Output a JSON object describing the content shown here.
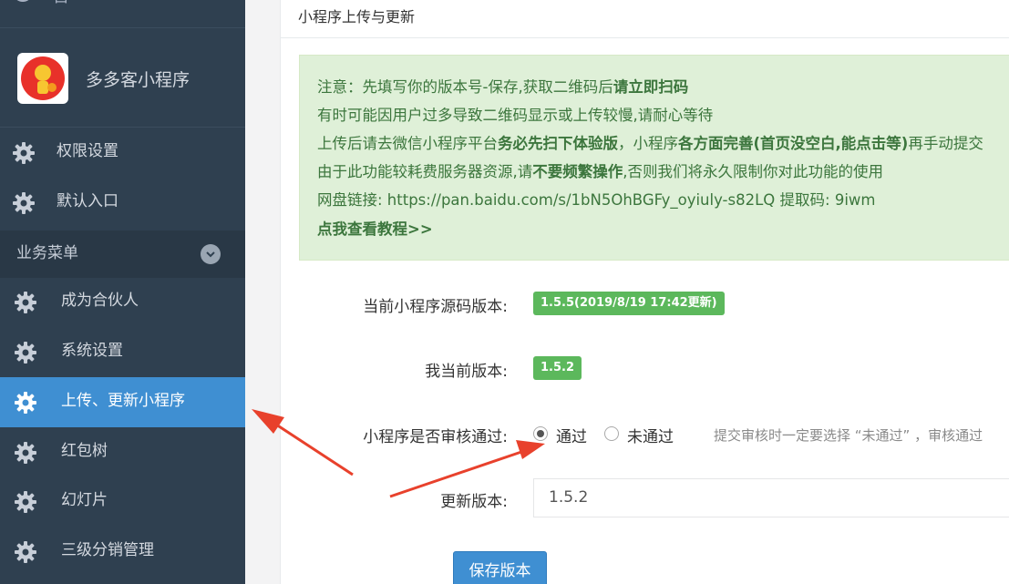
{
  "sidebar": {
    "top_partial_label": "首",
    "brand_name": "多多客小程序",
    "items": [
      {
        "label": "权限设置",
        "icon": "gear-icon"
      },
      {
        "label": "默认入口",
        "icon": "gear-icon"
      }
    ],
    "group": {
      "label": "业务菜单",
      "icon": "chevron-down-icon"
    },
    "sub_items": [
      {
        "label": "成为合伙人",
        "icon": "gear-icon"
      },
      {
        "label": "系统设置",
        "icon": "gear-icon"
      },
      {
        "label": "上传、更新小程序",
        "icon": "gear-icon",
        "active": true
      },
      {
        "label": "红包树",
        "icon": "gear-icon"
      },
      {
        "label": "幻灯片",
        "icon": "gear-icon"
      },
      {
        "label": "三级分销管理",
        "icon": "gear-icon"
      }
    ]
  },
  "panel": {
    "title": "小程序上传与更新",
    "notice": {
      "line1_prefix": "注意：先填写你的版本号-保存,获取二维码后",
      "line1_bold": "请立即扫码",
      "line2": "有时可能因用户过多导致二维码显示或上传较慢,请耐心等待",
      "line3_a": "上传后请去微信小程序平台",
      "line3_b": "务必先扫下体验版",
      "line3_c": "，小程序",
      "line3_d": "各方面完善(首页没空白,能点击等)",
      "line3_e": "再手动提交",
      "line4_a": "由于此功能较耗费服务器资源,请",
      "line4_b": "不要频繁操作",
      "line4_c": ",否则我们将永久限制你对此功能的使用",
      "line5": "网盘链接: https://pan.baidu.com/s/1bN5OhBGFy_oyiuly-s82LQ 提取码: 9iwm",
      "line6": "点我查看教程>>"
    },
    "source_version_label": "当前小程序源码版本:",
    "source_version_value": "1.5.5(2019/8/19 17:42更新)",
    "my_version_label": "我当前版本:",
    "my_version_value": "1.5.2",
    "audit_label": "小程序是否审核通过:",
    "audit_options": [
      "通过",
      "未通过"
    ],
    "audit_selected": "通过",
    "audit_hint": "提交审核时一定要选择 “未通过” ，审核通过",
    "update_version_label": "更新版本:",
    "update_version_value": "1.5.2",
    "save_button": "保存版本"
  },
  "colors": {
    "sidebar_bg": "#2f4050",
    "active_bg": "#3f8fd2",
    "badge_green": "#5cb85c",
    "notice_bg": "#dff0d8",
    "notice_text": "#3c763d",
    "arrow_red": "#e8412c"
  }
}
